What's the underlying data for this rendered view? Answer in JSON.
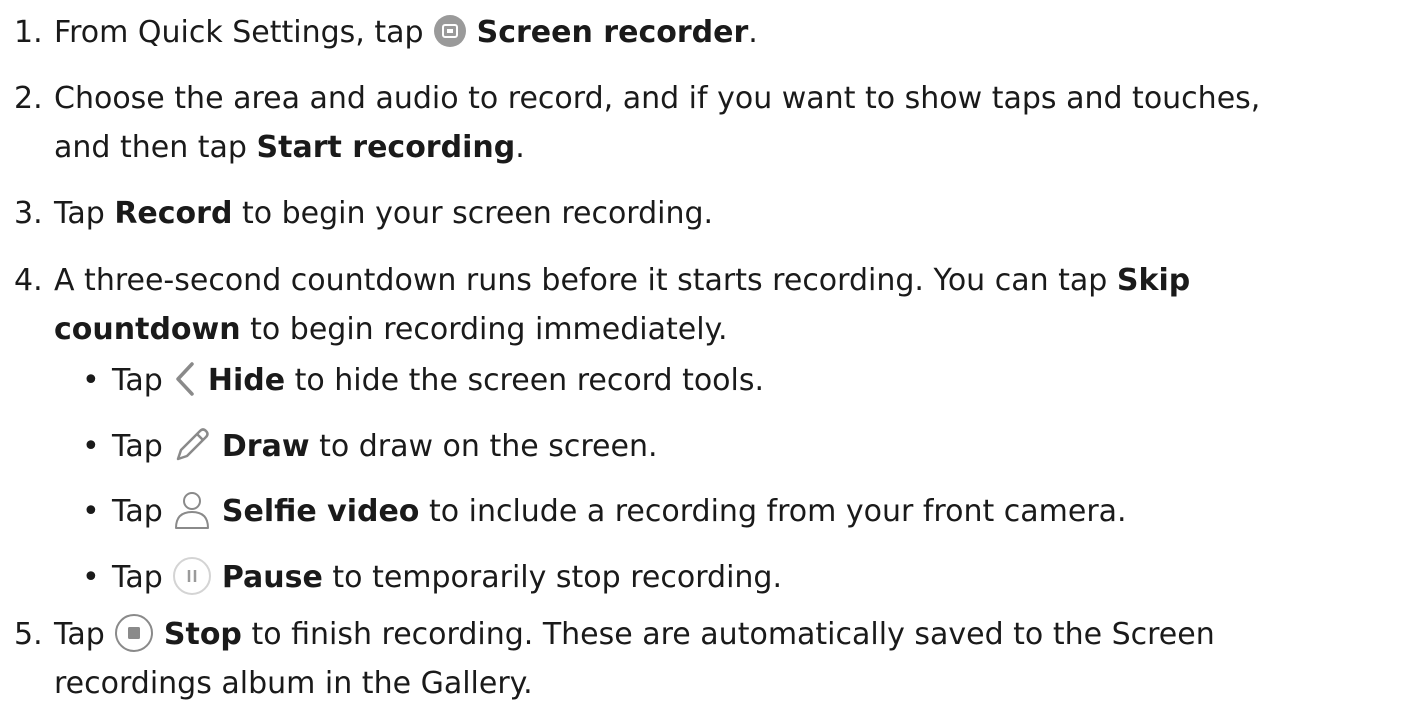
{
  "steps": [
    {
      "number": "1.",
      "pre": "From Quick Settings, tap ",
      "bold": "Screen recorder",
      "post": ".",
      "icon": "screen-recorder-icon"
    },
    {
      "number": "2.",
      "line1": "Choose the area and audio to record, and if you want to show taps and touches,",
      "line2_pre": "and then tap ",
      "bold": "Start recording",
      "post": "."
    },
    {
      "number": "3.",
      "pre": "Tap ",
      "bold": "Record",
      "post": " to begin your screen recording."
    },
    {
      "number": "4.",
      "line1_pre": "A three-second countdown runs before it starts recording. You can tap ",
      "bold1": "Skip",
      "bold2": "countdown",
      "line2_post": " to begin recording immediately."
    },
    {
      "number": "5.",
      "pre": "Tap ",
      "bold": "Stop",
      "post": " to finish recording. These are automatically saved to the Screen",
      "line2": "recordings album in the Gallery.",
      "icon": "stop-icon"
    }
  ],
  "bullets": [
    {
      "dot": "•",
      "pre": "Tap ",
      "bold": "Hide",
      "post": " to hide the screen record tools.",
      "icon": "chevron-left-icon"
    },
    {
      "dot": "•",
      "pre": "Tap ",
      "bold": "Draw",
      "post": " to draw on the screen.",
      "icon": "pencil-icon"
    },
    {
      "dot": "•",
      "pre": "Tap ",
      "bold": "Selfie video",
      "post": " to include a recording from your front camera.",
      "icon": "person-icon"
    },
    {
      "dot": "•",
      "pre": "Tap ",
      "bold": "Pause",
      "post": " to temporarily stop recording.",
      "icon": "pause-icon"
    }
  ]
}
